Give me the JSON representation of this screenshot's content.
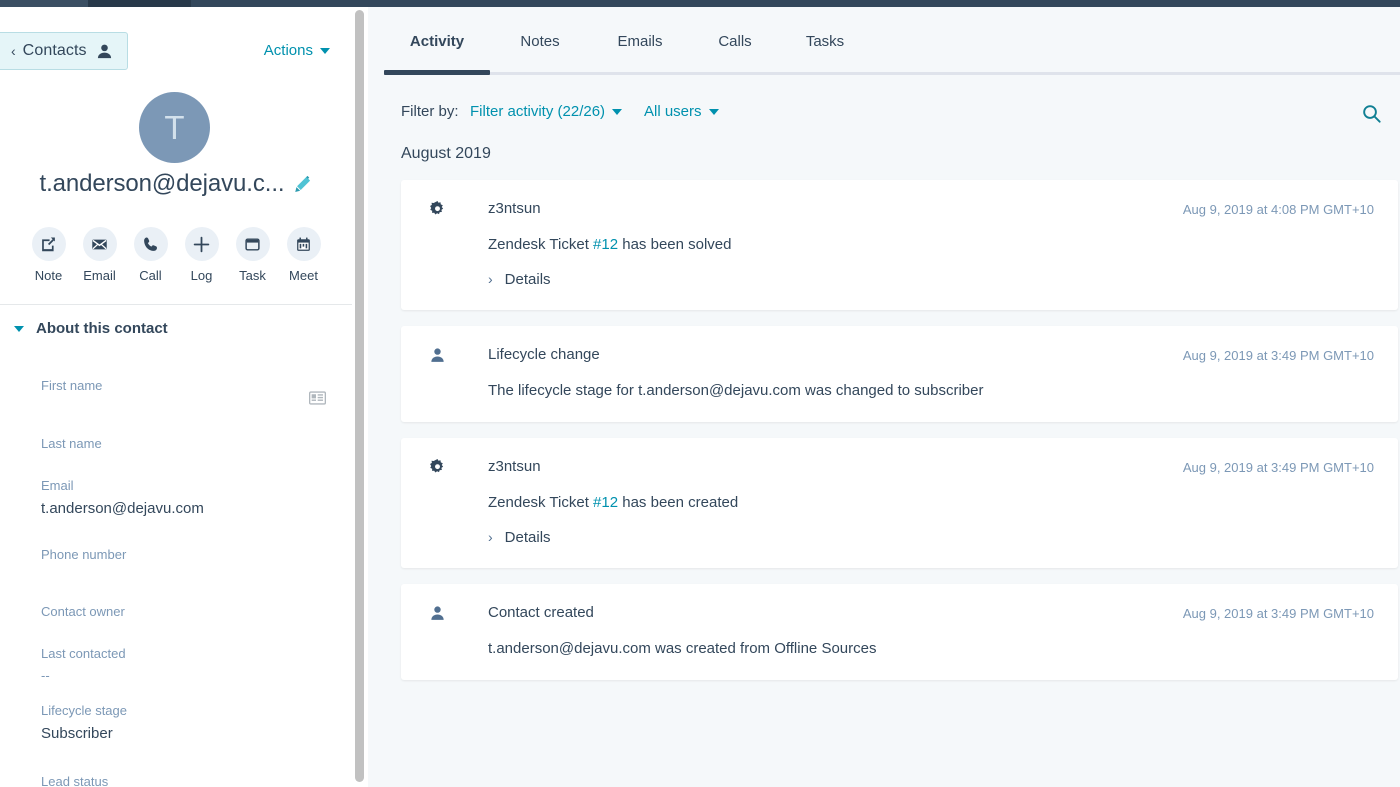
{
  "sidebar": {
    "back_button": {
      "label": "Contacts",
      "chevron": "‹",
      "icon": "person-icon"
    },
    "actions_menu": {
      "label": "Actions",
      "icon": "chevron-down-icon"
    },
    "avatar": {
      "initial": "T"
    },
    "contact_name": "t.anderson@dejavu.c...",
    "edit_icon": "pencil-icon",
    "quick_actions": [
      {
        "label": "Note",
        "icon": "note-icon"
      },
      {
        "label": "Email",
        "icon": "envelope-icon"
      },
      {
        "label": "Call",
        "icon": "phone-icon"
      },
      {
        "label": "Log",
        "icon": "plus-icon"
      },
      {
        "label": "Task",
        "icon": "task-card-icon"
      },
      {
        "label": "Meet",
        "icon": "calendar-icon"
      }
    ],
    "about": {
      "title": "About this contact",
      "collapse_icon": "chevron-down-icon",
      "vcard_icon": "contact-card-icon",
      "fields": [
        {
          "label": "First name",
          "value": ""
        },
        {
          "label": "Last name",
          "value": ""
        },
        {
          "label": "Email",
          "value": "t.anderson@dejavu.com"
        },
        {
          "label": "Phone number",
          "value": ""
        },
        {
          "label": "Contact owner",
          "value": ""
        },
        {
          "label": "Last contacted",
          "value": "--"
        },
        {
          "label": "Lifecycle stage",
          "value": "Subscriber"
        },
        {
          "label": "Lead status",
          "value": ""
        }
      ]
    }
  },
  "main": {
    "tabs": [
      {
        "label": "Activity",
        "active": true
      },
      {
        "label": "Notes",
        "active": false
      },
      {
        "label": "Emails",
        "active": false
      },
      {
        "label": "Calls",
        "active": false
      },
      {
        "label": "Tasks",
        "active": false
      }
    ],
    "filter_bar": {
      "prefix": "Filter by:",
      "activity_filter": "Filter activity (22/26)",
      "user_filter": "All users",
      "search_icon": "search-icon"
    },
    "timeline": {
      "month_label": "August 2019",
      "entries": [
        {
          "icon": "gear-icon",
          "title": "z3ntsun",
          "timestamp": "Aug 9, 2019 at 4:08 PM GMT+10",
          "body_prefix": "Zendesk Ticket ",
          "body_link": "#12",
          "body_suffix": " has been solved",
          "details_label": "Details",
          "has_details": true
        },
        {
          "icon": "contact-person-icon",
          "title": "Lifecycle change",
          "timestamp": "Aug 9, 2019 at 3:49 PM GMT+10",
          "body_prefix": "The lifecycle stage for t.anderson@dejavu.com was changed to subscriber",
          "body_link": "",
          "body_suffix": "",
          "details_label": "",
          "has_details": false
        },
        {
          "icon": "gear-icon",
          "title": "z3ntsun",
          "timestamp": "Aug 9, 2019 at 3:49 PM GMT+10",
          "body_prefix": "Zendesk Ticket ",
          "body_link": "#12",
          "body_suffix": " has been created",
          "details_label": "Details",
          "has_details": true
        },
        {
          "icon": "contact-person-icon",
          "title": "Contact created",
          "timestamp": "Aug 9, 2019 at 3:49 PM GMT+10",
          "body_prefix": "t.anderson@dejavu.com was created from Offline Sources",
          "body_link": "",
          "body_suffix": "",
          "details_label": "",
          "has_details": false
        }
      ]
    }
  },
  "colors": {
    "accent_teal": "#0091ae",
    "navy": "#33475b",
    "muted": "#7c98b6",
    "panel_bg": "#f5f8fa",
    "avatar_bg": "#7c98b6",
    "icon_bg": "#eaf0f6"
  }
}
